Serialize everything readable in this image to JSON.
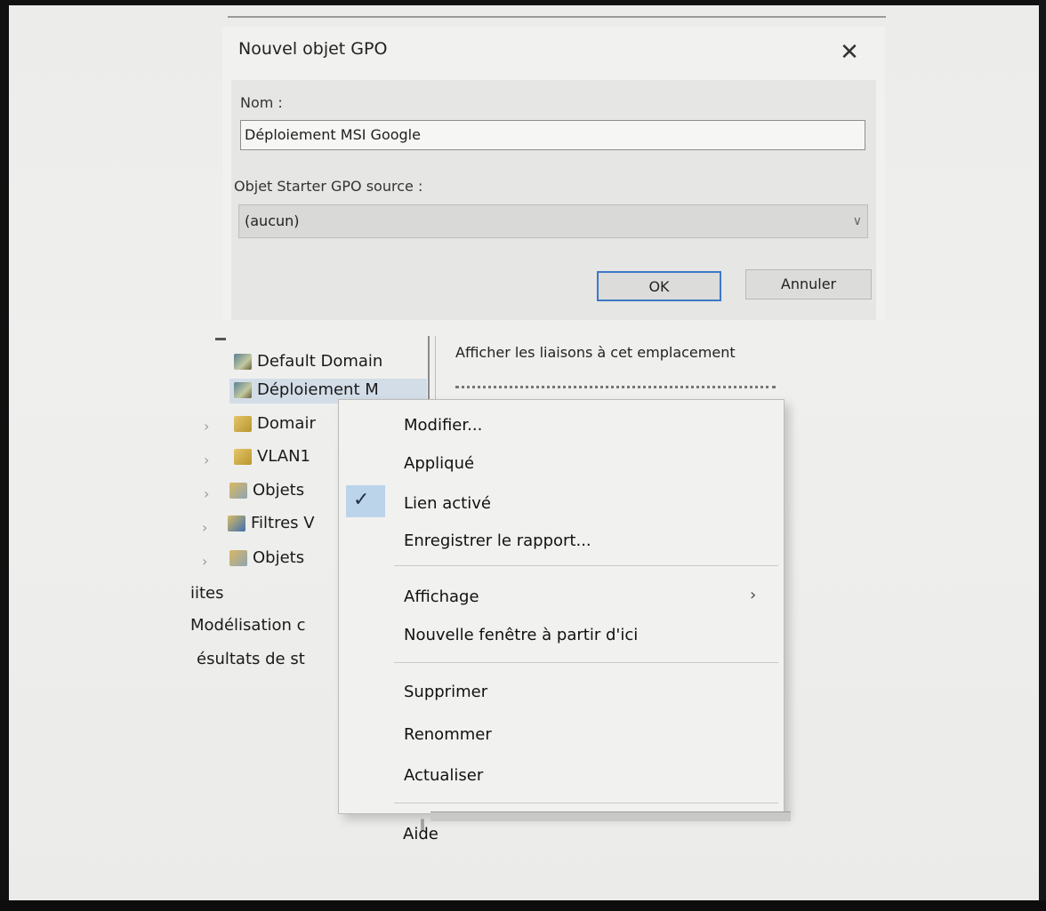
{
  "dialog": {
    "title": "Nouvel objet GPO",
    "close_label": "✕",
    "name_label": "Nom :",
    "name_value": "Déploiement MSI Google",
    "starter_label": "Objet Starter GPO source :",
    "starter_value": "(aucun)",
    "ok_label": "OK",
    "cancel_label": "Annuler"
  },
  "tree": {
    "items": [
      {
        "label": "Default Domain",
        "icon": "gpo-link-icon"
      },
      {
        "label": "Déploiement M",
        "icon": "gpo-link-icon",
        "selected": true
      },
      {
        "label": "Domair",
        "icon": "ou-folder-icon"
      },
      {
        "label": "VLAN1",
        "icon": "ou-folder-icon"
      },
      {
        "label": "Objets",
        "icon": "gpo-folder-icon"
      },
      {
        "label": "Filtres V",
        "icon": "wmi-folder-icon"
      },
      {
        "label": "Objets",
        "icon": "starter-folder-icon"
      },
      {
        "label": "iites"
      },
      {
        "label": "Modélisation c"
      },
      {
        "label": "ésultats de st"
      }
    ]
  },
  "right_pane": {
    "header": "Afficher les liaisons à cet emplacement"
  },
  "context_menu": {
    "items": [
      {
        "label": "Modifier..."
      },
      {
        "label": "Appliqué"
      },
      {
        "label": "Lien activé",
        "checked": true
      },
      {
        "label": "Enregistrer le rapport..."
      },
      {
        "label": "Affichage",
        "submenu": true
      },
      {
        "label": "Nouvelle fenêtre à partir d'ici"
      },
      {
        "label": "Supprimer"
      },
      {
        "label": "Renommer"
      },
      {
        "label": "Actualiser"
      },
      {
        "label": "Aide"
      }
    ],
    "check_glyph": "✓",
    "submenu_glyph": "›"
  },
  "colors": {
    "ok_border": "#3f78c8",
    "selection": "#d3dde8",
    "check_bg": "#bcd4ea"
  }
}
